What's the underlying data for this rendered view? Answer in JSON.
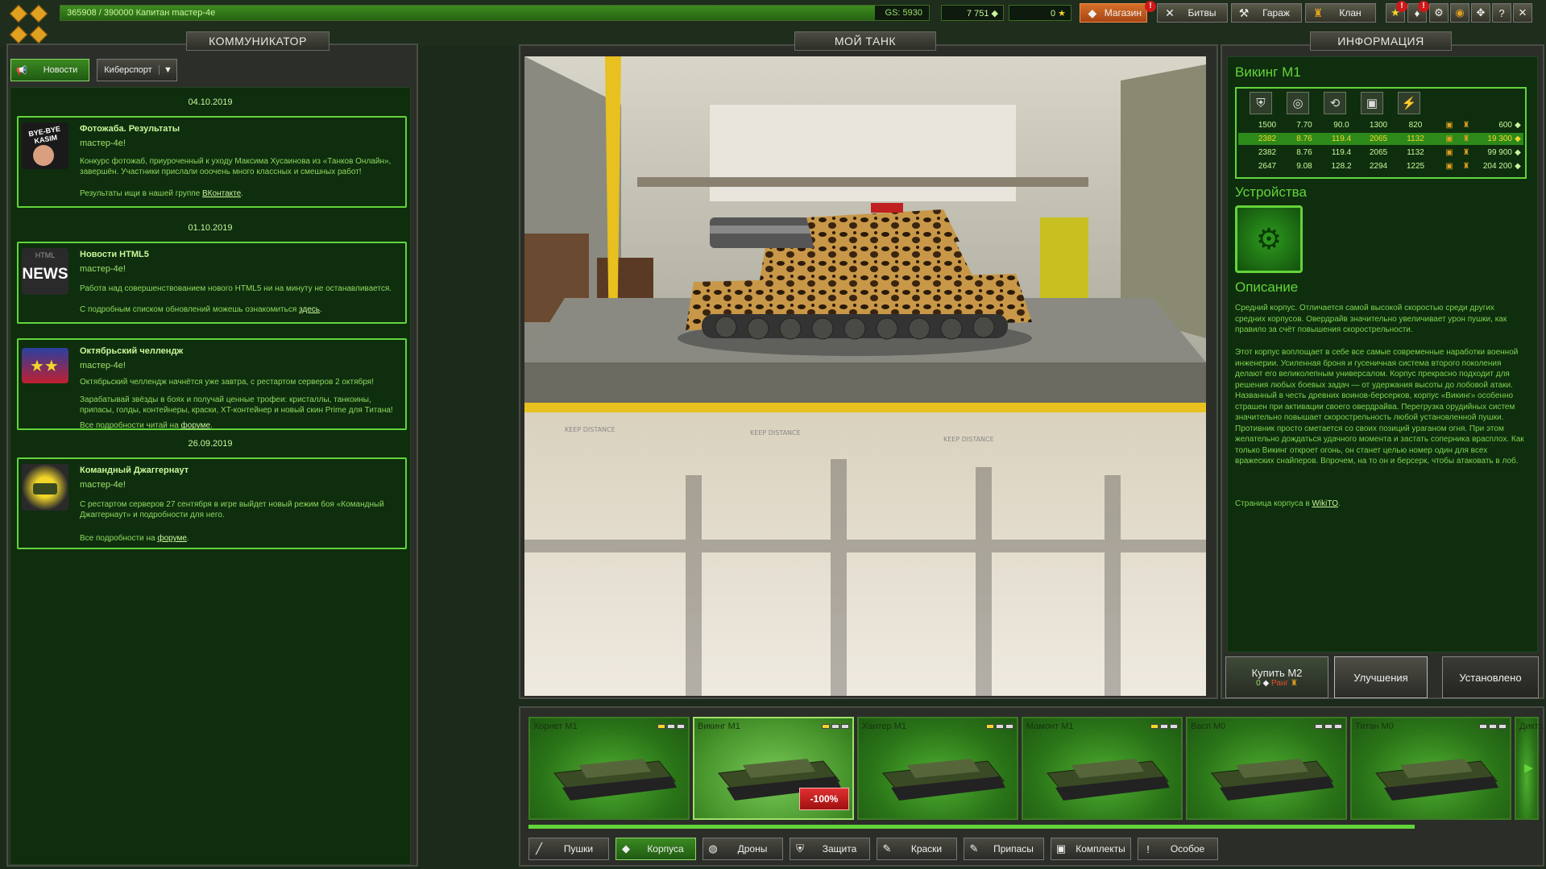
{
  "topbar": {
    "xp_text": "365908 / 390000  Капитан mастер-4е",
    "xp_progress": 0.938,
    "gs": "GS: 5930",
    "crystals": "7 751",
    "stars": "0",
    "buttons": {
      "shop": "Магазин",
      "battles": "Битвы",
      "garage": "Гараж",
      "clan": "Клан"
    },
    "shop_alert": "!",
    "icon_alert": "!"
  },
  "left": {
    "title": "КОММУНИКАТОР",
    "tab_news": "Новости",
    "tab_esports": "Киберспорт",
    "news": [
      {
        "date": "04.10.2019",
        "title": "Фотожаба. Результаты",
        "author": "mастер-4е!",
        "thumb_text": "BYE-BYE KASIM",
        "p1": "Конкурс фотожаб, приуроченный к уходу Максима Хусаинова из «Танков Онлайн», завершён. Участники прислали ооочень много классных и смешных работ!",
        "p2": "Результаты ищи в нашей группе",
        "p2_link": "ВКонтакте",
        "p2_end": "."
      },
      {
        "date": "01.10.2019",
        "title": "Новости HTML5",
        "author": "mастер-4е!",
        "thumb_text": "NEWS",
        "thumb_small": "HTML",
        "p1": "Работа над совершенствованием нового HTML5 ни на минуту не останавливается.",
        "p2": "С подробным списком обновлений можешь ознакомиться",
        "p2_link": "здесь",
        "p2_end": "."
      },
      {
        "title": "Октябрьский челлендж",
        "author": "mастер-4е!",
        "p1": "Октябрьский челлендж начнётся уже завтра, с рестартом серверов 2 октября!",
        "p2": "Зарабатывай звёзды в боях и получай ценные трофеи: кристаллы, танкоины, припасы, голды, контейнеры, краски, XT-контейнер и новый скин Prime для Титана!",
        "p3": "Все подробности читай на",
        "p3_link": "форуме",
        "p3_end": "."
      },
      {
        "date": "26.09.2019",
        "title": "Командный Джаггернаут",
        "author": "mастер-4е!",
        "p1": "С рестартом серверов 27 сентября в игре выйдет новый режим боя «Командный Джаггернаут» и подробности для него.",
        "p2": "Все подробности на",
        "p2_link": "форуме",
        "p2_end": "."
      }
    ]
  },
  "center": {
    "title": "МОЙ ТАНК",
    "floor_text": "KEEP DISTANCE"
  },
  "right": {
    "title": "ИНФОРМАЦИЯ",
    "hull_name": "Викинг М1",
    "stats_icons": [
      "shield-icon",
      "speed-icon",
      "turn-icon",
      "weight-icon",
      "power-icon"
    ],
    "stats_rows": [
      {
        "c": [
          "1500",
          "7.70",
          "90.0",
          "1300",
          "820"
        ],
        "price": "600",
        "selected": false
      },
      {
        "c": [
          "2382",
          "8.76",
          "119.4",
          "2065",
          "1132"
        ],
        "price": "19 300",
        "selected": true
      },
      {
        "c": [
          "2382",
          "8.76",
          "119.4",
          "2065",
          "1132"
        ],
        "price": "99 900",
        "selected": false
      },
      {
        "c": [
          "2647",
          "9.08",
          "128.2",
          "2294",
          "1225"
        ],
        "price": "204 200",
        "selected": false
      }
    ],
    "devices_title": "Устройства",
    "description_title": "Описание",
    "desc1": "Средний корпус. Отличается самой высокой скоростью среди других средних корпусов. Овердрайв значительно увеличивает урон пушки, как правило за счёт повышения скорострельности.",
    "desc2": "Этот корпус воплощает в себе все самые современные наработки военной инженерии. Усиленная броня и гусеничная система второго поколения делают его великолепным универсалом. Корпус прекрасно подходит для решения любых боевых задач — от удержания высоты до лобовой атаки. Названный в честь древних воинов-берсерков, корпус «Викинг» особенно страшен при активации своего овердрайва. Перегрузка орудийных систем значительно повышает скорострельность любой установленной пушки. Противник просто сметается со своих позиций ураганом огня. При этом желательно дождаться удачного момента и застать соперника врасплох. Как только Викинг откроет огонь, он станет целью номер один для всех вражеских снайперов. Впрочем, на то он и берсерк, чтобы атаковать в лоб.",
    "desc3": "Страница корпуса в",
    "desc3_link": "WikiTO",
    "desc3_end": ".",
    "buy_label": "Купить М2",
    "buy_price": "0",
    "buy_rank": "Ранг",
    "upgrade_label": "Улучшения",
    "installed_label": "Установлено"
  },
  "garage": {
    "hulls": [
      {
        "name": "Хорнет М1",
        "level": 1
      },
      {
        "name": "Викинг М1",
        "level": 1,
        "discount": "-100%"
      },
      {
        "name": "Хантер М1",
        "level": 1
      },
      {
        "name": "Мамонт М1",
        "level": 1
      },
      {
        "name": "Васп М0",
        "level": 0
      },
      {
        "name": "Титан М0",
        "level": 0
      },
      {
        "name": "Дикта",
        "level": 0
      }
    ],
    "categories": [
      "Пушки",
      "Корпуса",
      "Дроны",
      "Защита",
      "Краски",
      "Припасы",
      "Комплекты",
      "Особое"
    ],
    "selected_category": "Корпуса"
  }
}
